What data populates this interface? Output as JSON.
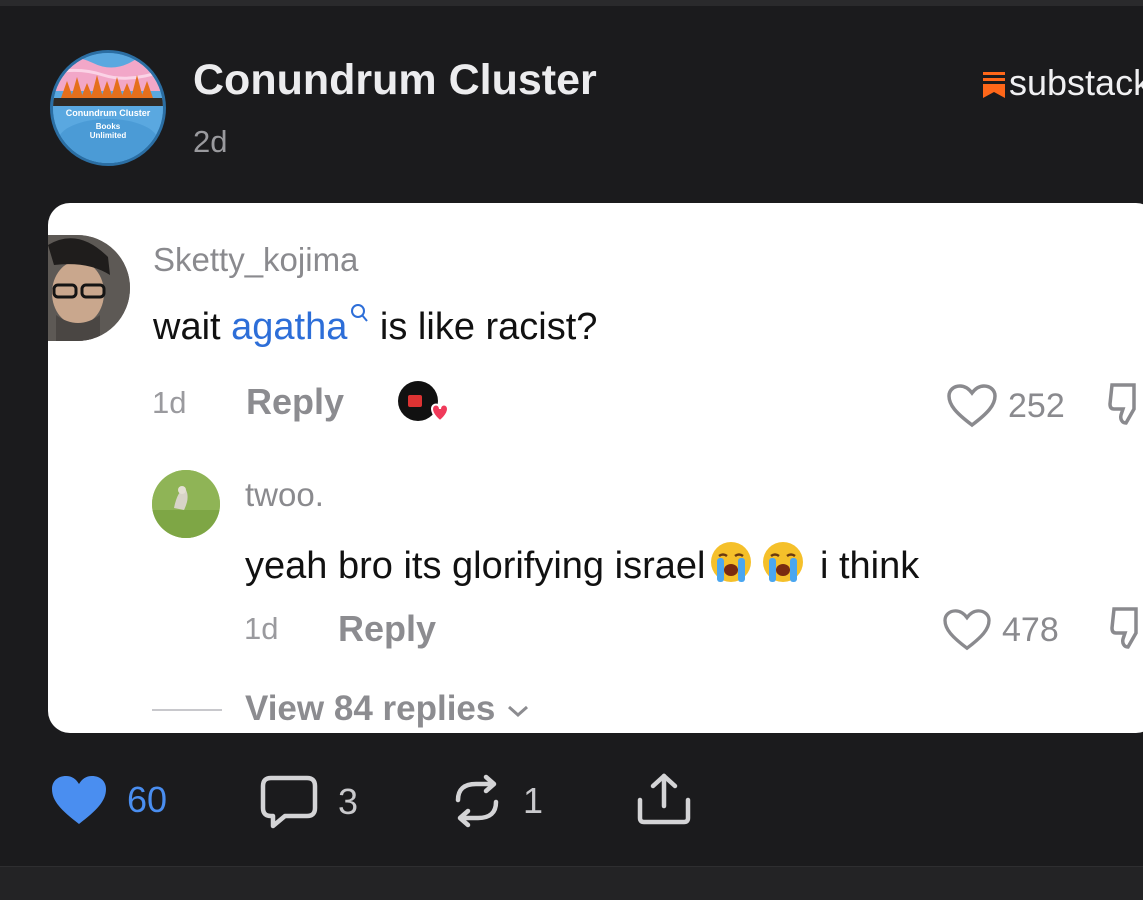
{
  "post": {
    "publication": "Conundrum Cluster",
    "time": "2d",
    "platform": "substack",
    "avatar_text": {
      "line1": "Conundrum Cluster",
      "line2": "Books",
      "line3": "Unlimited"
    }
  },
  "comments": [
    {
      "username": "Sketty_kojima",
      "text_before": "wait ",
      "link": "agatha",
      "text_after": " is like racist?",
      "time": "1d",
      "reply_label": "Reply",
      "likes": "252"
    },
    {
      "username": "twoo.",
      "text_before": "yeah bro its glorifying israel",
      "text_after": " i think",
      "time": "1d",
      "reply_label": "Reply",
      "likes": "478"
    }
  ],
  "view_replies": "View 84 replies",
  "actions": {
    "likes": "60",
    "comments": "3",
    "restacks": "1"
  },
  "colors": {
    "background": "#1b1b1d",
    "like_blue": "#4a8ef0",
    "link_blue": "#2d6ed8",
    "substack_orange": "#ff6719"
  }
}
